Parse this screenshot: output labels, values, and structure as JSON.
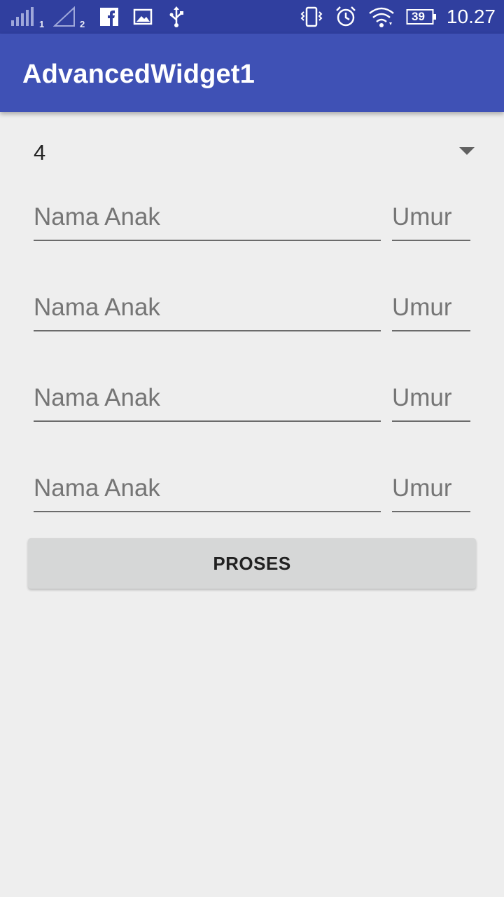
{
  "status_bar": {
    "sim1_label": "1",
    "sim2_label": "2",
    "battery_level": "39",
    "time": "10.27",
    "icons": [
      "signal-sim1-icon",
      "signal-sim2-icon",
      "facebook-icon",
      "gallery-icon",
      "usb-icon",
      "vibrate-icon",
      "alarm-icon",
      "wifi-icon",
      "battery-icon"
    ]
  },
  "app_bar": {
    "title": "AdvancedWidget1"
  },
  "spinner": {
    "selected": "4"
  },
  "fields": [
    {
      "nama_placeholder": "Nama Anak",
      "umur_placeholder": "Umur"
    },
    {
      "nama_placeholder": "Nama Anak",
      "umur_placeholder": "Umur"
    },
    {
      "nama_placeholder": "Nama Anak",
      "umur_placeholder": "Umur"
    },
    {
      "nama_placeholder": "Nama Anak",
      "umur_placeholder": "Umur"
    }
  ],
  "button": {
    "label": "PROSES"
  },
  "colors": {
    "primary": "#3f51b5",
    "primary_dark": "#303f9f",
    "background": "#eeeeee",
    "button": "#d6d7d7"
  }
}
